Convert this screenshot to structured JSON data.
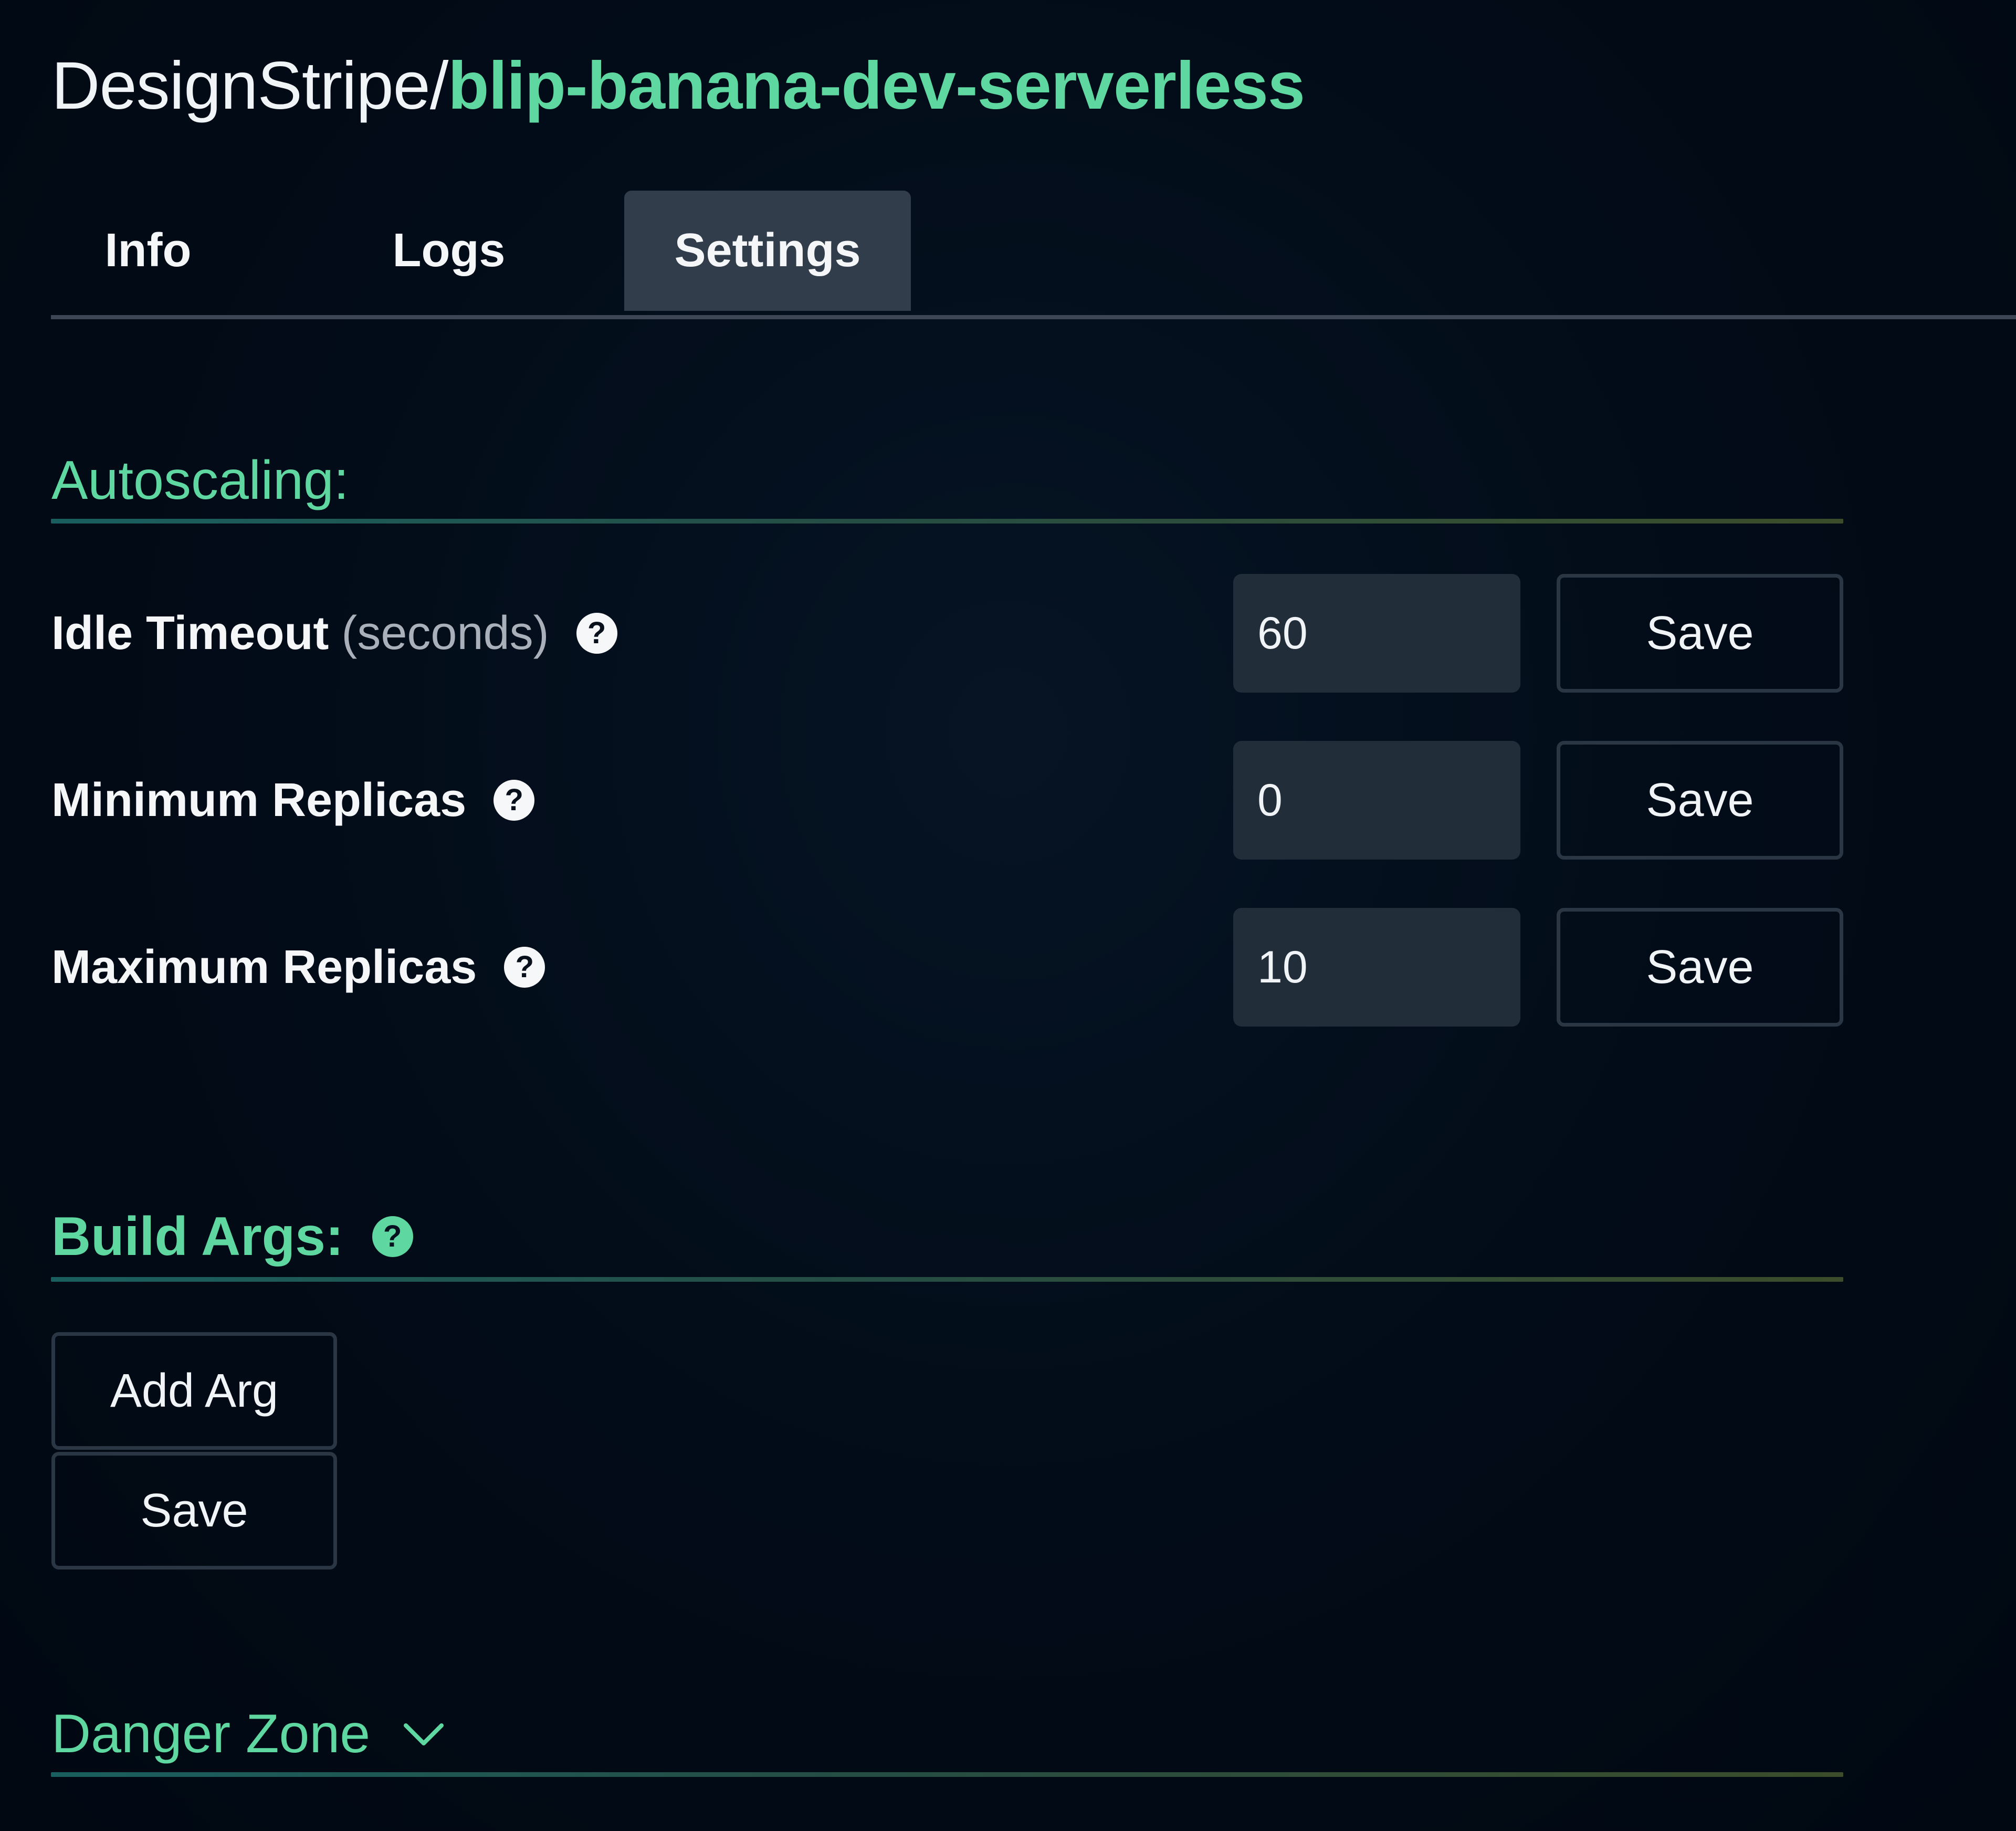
{
  "header": {
    "org": "DesignStripe",
    "separator": "/",
    "repo": "blip-banana-dev-serverless"
  },
  "tabs": [
    {
      "label": "Info",
      "active": false
    },
    {
      "label": "Logs",
      "active": false
    },
    {
      "label": "Settings",
      "active": true
    }
  ],
  "autoscaling": {
    "title": "Autoscaling:",
    "rows": [
      {
        "label": "Idle Timeout",
        "unit": "(seconds)",
        "value": "60",
        "save_label": "Save",
        "help_icon": "question-circle-icon"
      },
      {
        "label": "Minimum Replicas",
        "unit": "",
        "value": "0",
        "save_label": "Save",
        "help_icon": "question-circle-icon"
      },
      {
        "label": "Maximum Replicas",
        "unit": "",
        "value": "10",
        "save_label": "Save",
        "help_icon": "question-circle-icon"
      }
    ]
  },
  "build_args": {
    "title": "Build Args:",
    "help_icon": "question-circle-icon",
    "add_label": "Add Arg",
    "save_label": "Save"
  },
  "danger_zone": {
    "title": "Danger Zone",
    "toggle_icon": "chevron-down-icon"
  },
  "colors": {
    "background": "#020c18",
    "accent": "#5ed8a0",
    "input_bg": "#222d3a",
    "tab_active_bg": "#323d4b",
    "button_border": "#2b3644"
  }
}
